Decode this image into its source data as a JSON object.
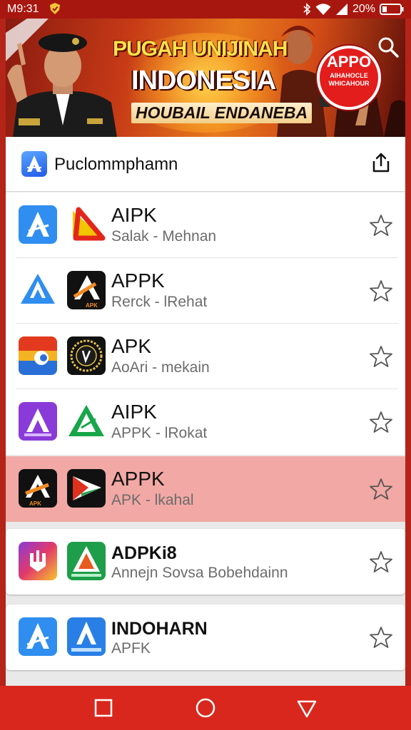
{
  "status_bar": {
    "time": "M9:31",
    "battery_percent": "20%",
    "icons": [
      "notification-shield-icon",
      "bluetooth-icon",
      "wifi-icon",
      "signal-icon",
      "battery-icon"
    ]
  },
  "banner": {
    "headline": "PUGAH UNIJINAH",
    "title": "INDONESIA",
    "subtitle": "HOUBAIL ENDANEBA",
    "badge_title": "APPO",
    "badge_text": "AIHAHOCLE WHICAHOUR"
  },
  "app_bar": {
    "title": "Puclommphamn",
    "logo_icon": "app-store-a-icon",
    "share_icon": "share-icon"
  },
  "apps": [
    {
      "name": "AIPK",
      "subtitle": "Salak - Mehnan",
      "favorite": false
    },
    {
      "name": "APPK",
      "subtitle": "Rerck - lRehat",
      "favorite": false,
      "icon_b_text": "APK"
    },
    {
      "name": "APK",
      "subtitle": "AoAri - mekain",
      "favorite": false
    },
    {
      "name": "AIPK",
      "subtitle": "APPK - lRokat",
      "favorite": false
    },
    {
      "name": "APPK",
      "subtitle": "APK - lkahal",
      "favorite": false,
      "selected": true,
      "icon_a_text": "APK"
    },
    {
      "name": "ADPKi8",
      "subtitle": "Annejn Sovsa Bobehdainn",
      "favorite": false
    },
    {
      "name": "INDOHARN",
      "subtitle": "APFK",
      "favorite": false
    }
  ],
  "nav_bar": {
    "buttons": [
      "recents-square-icon",
      "home-circle-icon",
      "back-triangle-icon"
    ]
  },
  "colors": {
    "status_bar": "#a8170f",
    "nav_bar": "#d9271d",
    "selected_row": "#f2a8a4",
    "accent_blue": "#2f7ff0"
  }
}
